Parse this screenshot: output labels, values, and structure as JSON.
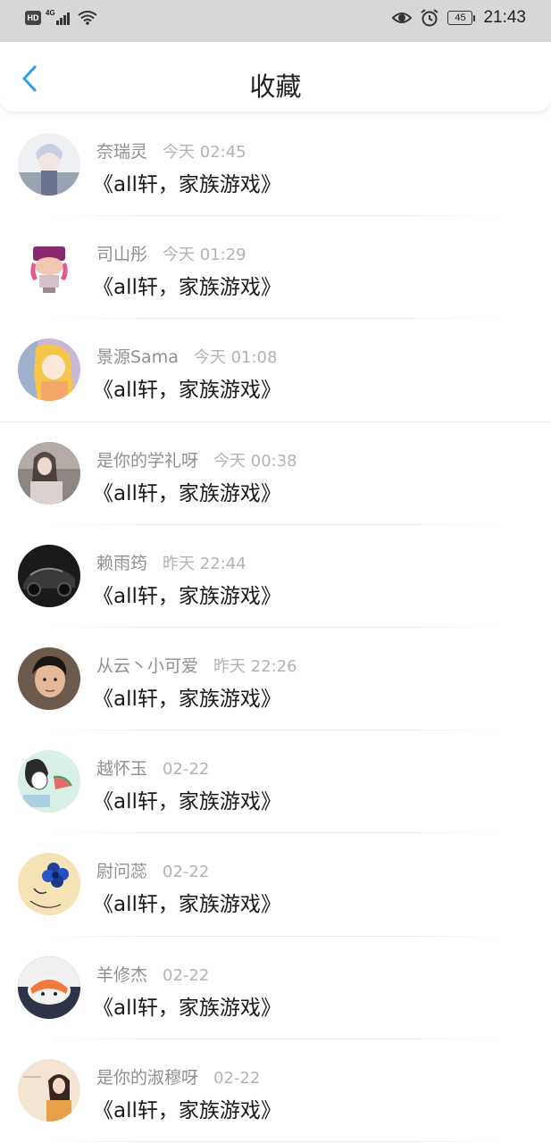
{
  "status_bar": {
    "hd": "HD",
    "network": "4G",
    "battery": "45",
    "time": "21:43"
  },
  "header": {
    "title": "收藏"
  },
  "list": [
    {
      "name": "奈瑞灵",
      "time": "今天 02:45",
      "title": "《all轩，家族游戏》"
    },
    {
      "name": "司山彤",
      "time": "今天 01:29",
      "title": "《all轩，家族游戏》"
    },
    {
      "name": "景源Sama",
      "time": "今天 01:08",
      "title": "《all轩，家族游戏》"
    },
    {
      "name": "是你的学礼呀",
      "time": "今天 00:38",
      "title": "《all轩，家族游戏》"
    },
    {
      "name": "赖雨筠",
      "time": "昨天 22:44",
      "title": "《all轩，家族游戏》"
    },
    {
      "name": "从云丶小可爱",
      "time": "昨天 22:26",
      "title": "《all轩，家族游戏》"
    },
    {
      "name": "越怀玉",
      "time": "02-22",
      "title": "《all轩，家族游戏》"
    },
    {
      "name": "尉问蕊",
      "time": "02-22",
      "title": "《all轩，家族游戏》"
    },
    {
      "name": "羊修杰",
      "time": "02-22",
      "title": "《all轩，家族游戏》"
    },
    {
      "name": "是你的淑穆呀",
      "time": "02-22",
      "title": "《all轩，家族游戏》"
    }
  ],
  "colors": {
    "accent": "#2a9df4",
    "status_bar_bg": "#d7d7d7",
    "name_text": "#8f8f8f",
    "time_text": "#b3b3b3",
    "title_text": "#1a1a1a"
  }
}
